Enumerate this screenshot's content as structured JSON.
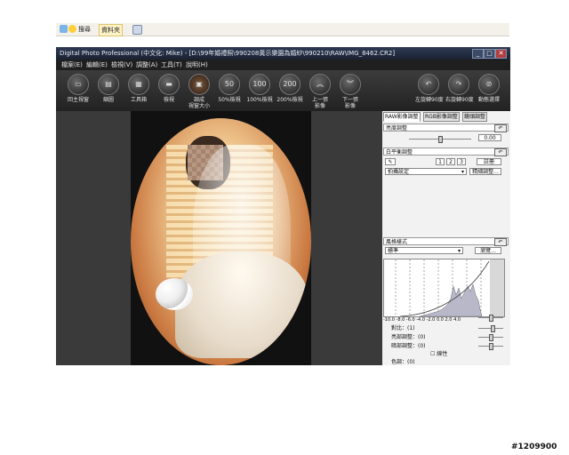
{
  "explorer": {
    "search_label": "搜尋",
    "folders_label": "資料夾"
  },
  "window": {
    "title": "Digital Photo Professional (中文化: Mike) - [D:\\99年婚禮照\\990208黃示樂園為婚紗\\990210\\RAW\\IMG_8462.CR2]",
    "controls": [
      "_",
      "□",
      "✕"
    ]
  },
  "menu": [
    "檔案(E)",
    "編輯(E)",
    "檢視(V)",
    "調整(A)",
    "工具(T)",
    "說明(H)"
  ],
  "toolbar": [
    {
      "label": "回主視窗",
      "icon": "home-window-icon"
    },
    {
      "label": "縮圖",
      "icon": "thumbnail-icon"
    },
    {
      "label": "工具箱",
      "icon": "toolbox-icon"
    },
    {
      "label": "檢視",
      "icon": "view-icon"
    },
    {
      "label": "調成\n視窗大小",
      "icon": "fit-window-icon"
    },
    {
      "label": "50%檢視",
      "icon": "zoom-50-icon",
      "glyph": "50"
    },
    {
      "label": "100%檢視",
      "icon": "zoom-100-icon",
      "glyph": "100"
    },
    {
      "label": "200%檢視",
      "icon": "zoom-200-icon",
      "glyph": "200"
    },
    {
      "label": "上一張\n影像",
      "icon": "previous-image-icon",
      "glyph": "︽"
    },
    {
      "label": "下一張\n影像",
      "icon": "next-image-icon",
      "glyph": "︾"
    },
    {
      "label": "左旋轉90度",
      "icon": "rotate-left-icon",
      "glyph": "↶"
    },
    {
      "label": "右旋轉90度",
      "icon": "rotate-right-icon",
      "glyph": "↷"
    },
    {
      "label": "動態選擇",
      "icon": "dynamic-select-icon",
      "glyph": "⊘"
    }
  ],
  "panel": {
    "tabs": [
      "RAW影像調整",
      "RGB影像調整",
      "鏡頭調整"
    ],
    "brightness": {
      "title": "亮度調整",
      "value": "0.00"
    },
    "white_balance": {
      "title": "白平衡調整",
      "presets": [
        "1",
        "2",
        "3"
      ],
      "register_label": "註冊",
      "mode": "拍攝設定",
      "fine_tune_label": "精細調整..."
    },
    "picture_style": {
      "title": "風格樣式",
      "value": "標準",
      "browse_label": "瀏覽..."
    },
    "hist_axis": [
      "-10.0",
      "-8.0",
      "-6.0",
      "-4.0",
      "-2.0",
      "0.0",
      "2.0",
      "4.0"
    ],
    "adjustments": [
      {
        "label": "對比：(1)"
      },
      {
        "label": "亮部調整：(0)"
      },
      {
        "label": "暗部調整：(0)"
      },
      {
        "label": "色調：(0)"
      },
      {
        "label": "飽和度：(2)"
      },
      {
        "label": "銳利度：(3)"
      }
    ],
    "linear_label": "線性"
  },
  "watermark": "#1209900"
}
